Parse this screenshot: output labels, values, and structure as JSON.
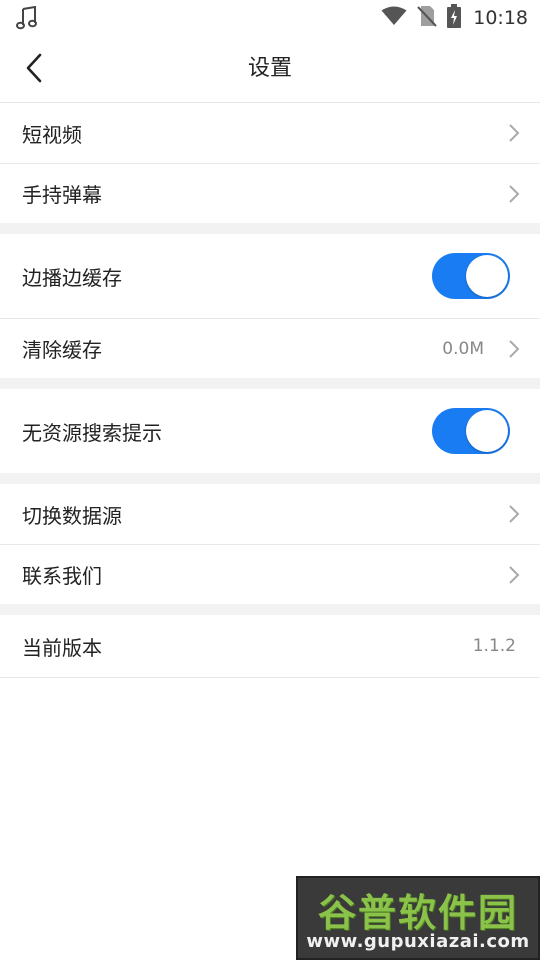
{
  "status_bar": {
    "time": "10:18",
    "icons": [
      "music-note-icon",
      "wifi-icon",
      "no-sim-icon",
      "battery-charging-icon"
    ]
  },
  "header": {
    "title": "设置",
    "back_icon": "chevron-left-icon"
  },
  "settings": {
    "short_video": {
      "label": "短视频"
    },
    "handheld_danmaku": {
      "label": "手持弹幕"
    },
    "cache_while_playing": {
      "label": "边播边缓存",
      "enabled": true
    },
    "clear_cache": {
      "label": "清除缓存",
      "value": "0.0M"
    },
    "no_source_hint": {
      "label": "无资源搜索提示",
      "enabled": true
    },
    "switch_source": {
      "label": "切换数据源"
    },
    "contact_us": {
      "label": "联系我们"
    },
    "version": {
      "label": "当前版本",
      "value": "1.1.2"
    }
  },
  "watermark": {
    "title": "谷普软件园",
    "url": "www.gupuxiazai.com"
  },
  "colors": {
    "toggle_on": "#1a7cf2",
    "section_gap": "#f2f2f2",
    "watermark_green": "#8bc34a"
  }
}
